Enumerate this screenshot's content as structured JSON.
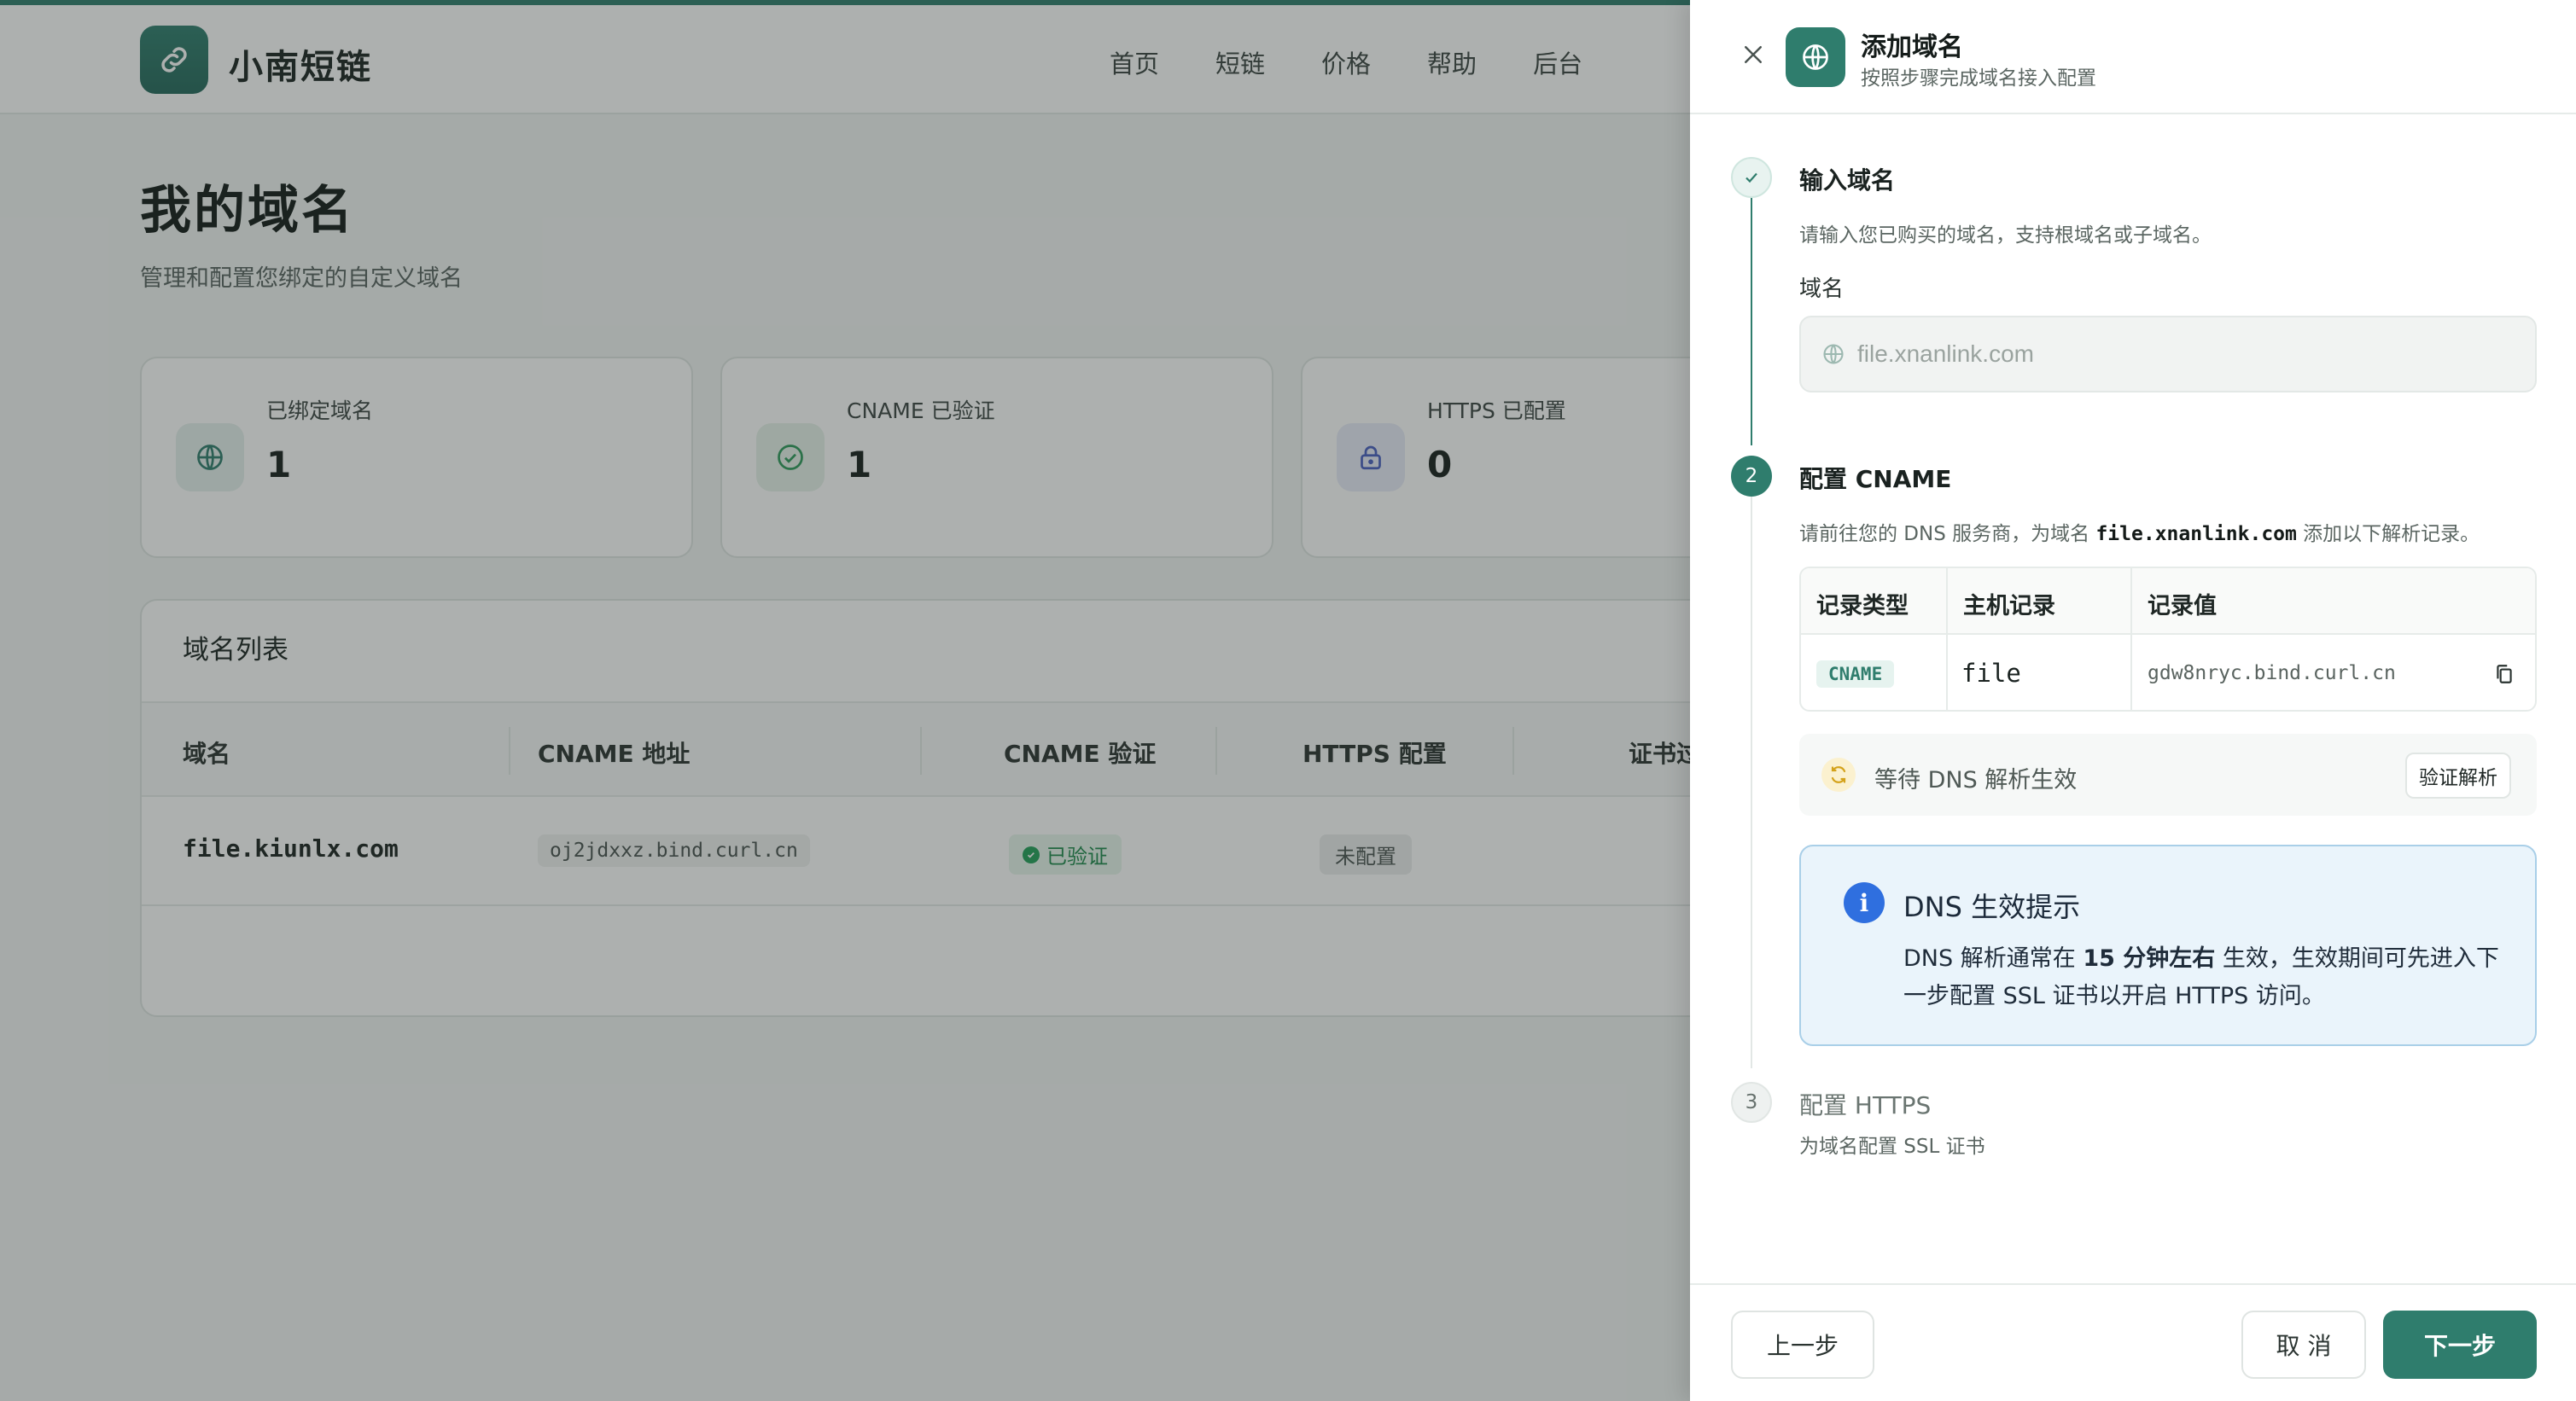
{
  "app": {
    "brand": "小南短链",
    "nav": [
      "首页",
      "短链",
      "价格",
      "帮助",
      "后台"
    ]
  },
  "page": {
    "title": "我的域名",
    "subtitle": "管理和配置您绑定的自定义域名"
  },
  "stats": [
    {
      "label": "已绑定域名",
      "value": "1",
      "icon": "globe-icon"
    },
    {
      "label": "CNAME 已验证",
      "value": "1",
      "icon": "check-circle-icon"
    },
    {
      "label": "HTTPS 已配置",
      "value": "0",
      "icon": "lock-icon"
    }
  ],
  "domain_list": {
    "title": "域名列表",
    "columns": [
      "域名",
      "CNAME 地址",
      "CNAME 验证",
      "HTTPS 配置",
      "证书过"
    ],
    "rows": [
      {
        "domain": "file.kiunlx.com",
        "cname": "oj2jdxxz.bind.curl.cn",
        "cname_status": "已验证",
        "https_status": "未配置"
      }
    ]
  },
  "drawer": {
    "title": "添加域名",
    "subtitle": "按照步骤完成域名接入配置",
    "step1": {
      "title": "输入域名",
      "desc": "请输入您已购买的域名，支持根域名或子域名。",
      "field_label": "域名",
      "placeholder": "file.xnanlink.com"
    },
    "step2": {
      "number": "2",
      "title": "配置 CNAME",
      "desc_prefix": "请前往您的 DNS 服务商，为域名",
      "desc_domain": "file.xnanlink.com",
      "desc_suffix": "添加以下解析记录。",
      "table_headers": [
        "记录类型",
        "主机记录",
        "记录值"
      ],
      "record_type": "CNAME",
      "host": "file",
      "value": "gdw8nryc.bind.curl.cn",
      "wait_text": "等待 DNS 解析生效",
      "verify_button": "验证解析",
      "tip_title": "DNS 生效提示",
      "tip_body_prefix": "DNS 解析通常在",
      "tip_body_bold": "15 分钟左右",
      "tip_body_suffix": "生效，生效期间可先进入下一步配置 SSL 证书以开启 HTTPS 访问。"
    },
    "step3": {
      "number": "3",
      "title": "配置 HTTPS",
      "desc": "为域名配置 SSL 证书"
    },
    "footer": {
      "prev": "上一步",
      "cancel": "取 消",
      "next": "下一步"
    }
  },
  "colors": {
    "accent": "#2f7d6d",
    "info": "#2f6fdf",
    "success": "#23a05a"
  }
}
